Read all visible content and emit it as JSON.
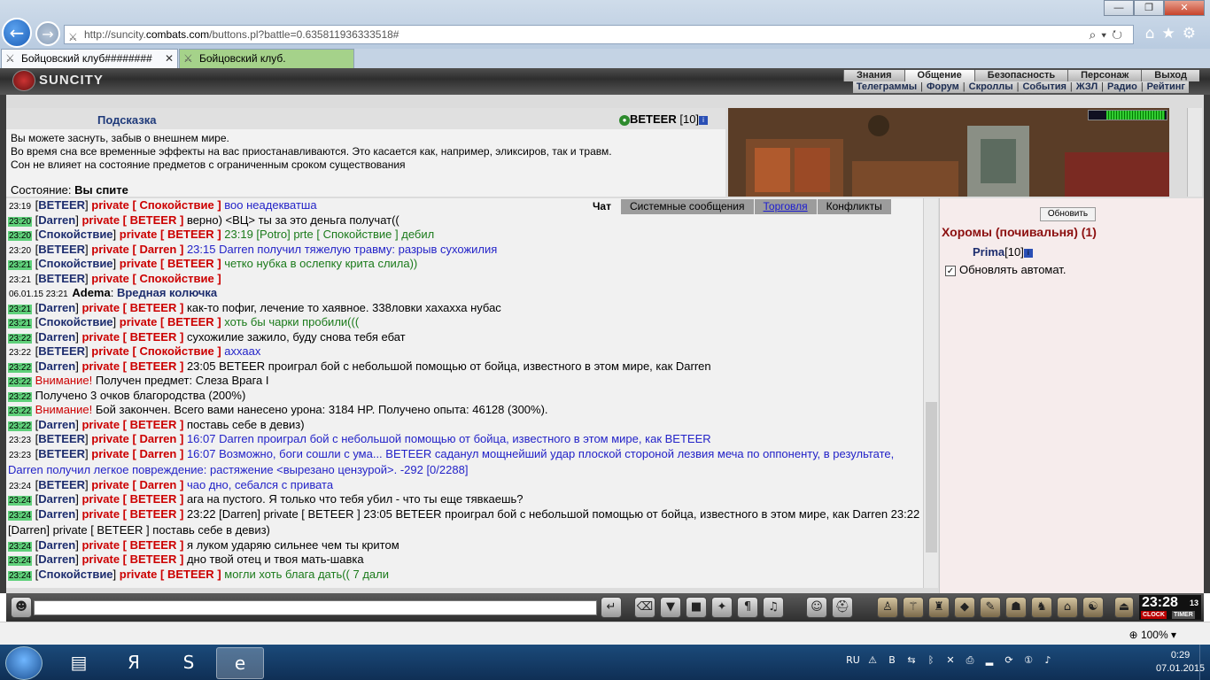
{
  "browser": {
    "url_prefix": "http://suncity.",
    "url_domain": "combats.com",
    "url_suffix": "/buttons.pl?battle=0.635811936333518#",
    "tabs": [
      {
        "label": "Бойцовский клуб########"
      },
      {
        "label": "Бойцовский клуб."
      }
    ],
    "zoom": "100%"
  },
  "game": {
    "logo": "SUNCITY",
    "menu_top": [
      "Знания",
      "Общение",
      "Безопасность",
      "Персонаж",
      "Выход"
    ],
    "menu_bottom": [
      "Телеграммы",
      "Форум",
      "Скроллы",
      "События",
      "ЖЗЛ",
      "Радио",
      "Рейтинг"
    ],
    "hint": {
      "title": "Подсказка",
      "user": "BETEER",
      "level": "[10]",
      "lines": [
        "Вы можете заснуть, забыв о внешнем мире.",
        "Во время сна все временные эффекты на вас приостанавливаются. Это касается как, например, эликсиров, так и травм.",
        "Сон не влияет на состояние предметов с ограниченным сроком существования"
      ],
      "state_label": "Состояние:",
      "state_value": "Вы спите"
    },
    "chat_tabs": [
      "Чат",
      "Системные сообщения",
      "Торговля",
      "Конфликты"
    ],
    "chat": [
      {
        "t": "23:19",
        "hl": false,
        "from": "",
        "to": "",
        "msg": "воо неадекватша",
        "mc": "b"
      },
      {
        "t": "23:19",
        "hl": false,
        "from": "BETEER",
        "to": "Спокойствие",
        "msg": "воо неадекватша",
        "mc": "b"
      },
      {
        "t": "23:20",
        "hl": true,
        "from": "Darren",
        "to": "BETEER",
        "msg": "верно) <ВЦ> ты за это деньга получат((",
        "mc": "k"
      },
      {
        "t": "23:20",
        "hl": true,
        "from": "Спокойствие",
        "to": "BETEER",
        "msg": "23:19 [Potro] prte [ Спокойствие ] дебил",
        "mc": "g"
      },
      {
        "t": "23:20",
        "hl": false,
        "from": "BETEER",
        "to": "Darren",
        "msg": "23:15 Darren получил тяжелую травму: разрыв сухожилия",
        "mc": "b"
      },
      {
        "t": "23:21",
        "hl": true,
        "from": "Спокойствие",
        "to": "BETEER",
        "msg": "четко нубка в ослепку крита слила))",
        "mc": "g"
      },
      {
        "t": "23:21",
        "hl": false,
        "from": "BETEER",
        "to": "Спокойствие",
        "msg": "",
        "mc": "b"
      },
      {
        "t": "06.01.15 23:21",
        "hl": false,
        "from": "Adema",
        "to": "",
        "msg": "Вредная колючка",
        "mc": "blue-bold"
      },
      {
        "t": "23:21",
        "hl": true,
        "from": "Darren",
        "to": "BETEER",
        "msg": "как-то пофиг, лечение то хаявное. 338ловки хахахха нубас",
        "mc": "k"
      },
      {
        "t": "23:21",
        "hl": true,
        "from": "Спокойствие",
        "to": "BETEER",
        "msg": "хоть бы чарки пробили(((",
        "mc": "g"
      },
      {
        "t": "23:22",
        "hl": true,
        "from": "Darren",
        "to": "BETEER",
        "msg": "сухожилие зажило, буду снова тебя ебат",
        "mc": "k"
      },
      {
        "t": "23:22",
        "hl": false,
        "from": "BETEER",
        "to": "Спокойствие",
        "msg": "аххаах",
        "mc": "b"
      },
      {
        "t": "23:22",
        "hl": true,
        "from": "Darren",
        "to": "BETEER",
        "msg": "23:05 BETEER проиграл бой с небольшой помощью от бойца, известного в этом мире, как Darren",
        "mc": "k"
      },
      {
        "t": "23:22",
        "hl": true,
        "sys": "Внимание!",
        "msg": "Получен предмет: Слеза Врага I"
      },
      {
        "t": "23:22",
        "hl": true,
        "sys": "",
        "msg": "Получено 3 очков благородства (200%)"
      },
      {
        "t": "23:22",
        "hl": true,
        "sys": "Внимание!",
        "msg": "Бой закончен. Всего вами нанесено урона: 3184 HP. Получено опыта: 46128 (300%)."
      },
      {
        "t": "23:22",
        "hl": true,
        "from": "Darren",
        "to": "BETEER",
        "msg": "поставь себе в девиз)",
        "mc": "k"
      },
      {
        "t": "23:23",
        "hl": false,
        "from": "BETEER",
        "to": "Darren",
        "msg": "16:07 Darren проиграл бой с небольшой помощью от бойца, известного в этом мире, как BETEER",
        "mc": "b"
      },
      {
        "t": "23:23",
        "hl": false,
        "from": "BETEER",
        "to": "Darren",
        "msg": "16:07 Возможно, боги сошли с ума... BETEER саданул мощнейший удар плоской стороной лезвия меча по оппоненту, в результате, Darren получил легкое повреждение: растяжение <вырезано цензурой>. -292 [0/2288]",
        "mc": "b",
        "wrap": true
      },
      {
        "t": "23:24",
        "hl": false,
        "from": "BETEER",
        "to": "Darren",
        "msg": "чао дно, себался с привата",
        "mc": "b"
      },
      {
        "t": "23:24",
        "hl": true,
        "from": "Darren",
        "to": "BETEER",
        "msg": "ага на пустого. Я только что тебя убил - что ты еще тявкаешь?",
        "mc": "k"
      },
      {
        "t": "23:24",
        "hl": true,
        "from": "Darren",
        "to": "BETEER",
        "msg": "23:22 [Darren] private [ BETEER ] 23:05 BETEER проиграл бой с небольшой помощью от бойца, известного в этом мире, как Darren 23:22 [Darren] private [ BETEER ] поставь себе в девиз)",
        "mc": "k",
        "wrap": true
      },
      {
        "t": "23:24",
        "hl": true,
        "from": "Darren",
        "to": "BETEER",
        "msg": "я луком ударяю сильнее чем ты критом",
        "mc": "k"
      },
      {
        "t": "23:24",
        "hl": true,
        "from": "Darren",
        "to": "BETEER",
        "msg": "дно твой отец и твоя мать-шавка",
        "mc": "k"
      },
      {
        "t": "23:24",
        "hl": true,
        "from": "Спокойствие",
        "to": "BETEER",
        "msg": "могли хоть блага дать(( 7 дали",
        "mc": "g"
      }
    ],
    "private_word": "private",
    "room": {
      "refresh": "Обновить",
      "title": "Хоромы (почивальня) (1)",
      "user": "Prima",
      "level": "[10]",
      "auto": "Обновлять автомат."
    },
    "clock": {
      "time": "23:28",
      "sec": "13",
      "clock_label": "CLOCK",
      "timer_label": "TIMER"
    }
  },
  "taskbar": {
    "lang": "RU",
    "time": "0:29",
    "date": "07.01.2015"
  }
}
